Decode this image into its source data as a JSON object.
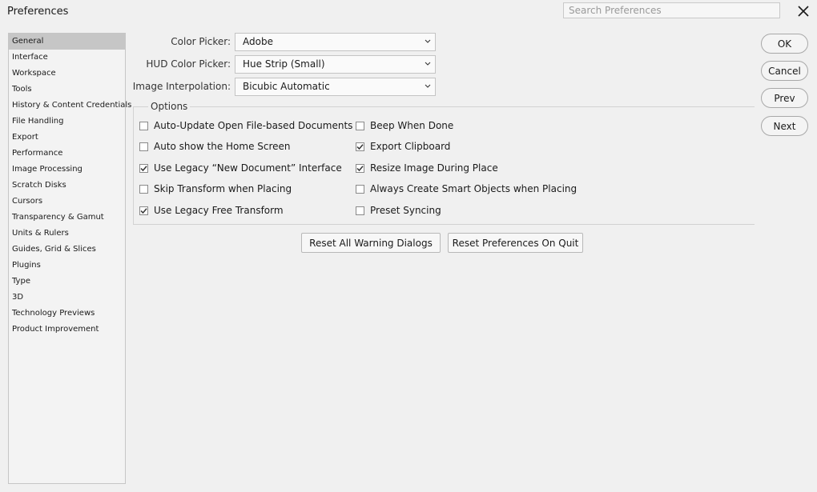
{
  "window": {
    "title": "Preferences"
  },
  "search": {
    "placeholder": "Search Preferences"
  },
  "sidebar": {
    "items": [
      {
        "label": "General",
        "selected": true
      },
      {
        "label": "Interface"
      },
      {
        "label": "Workspace"
      },
      {
        "label": "Tools"
      },
      {
        "label": "History & Content Credentials"
      },
      {
        "label": "File Handling"
      },
      {
        "label": "Export"
      },
      {
        "label": "Performance"
      },
      {
        "label": "Image Processing"
      },
      {
        "label": "Scratch Disks"
      },
      {
        "label": "Cursors"
      },
      {
        "label": "Transparency & Gamut"
      },
      {
        "label": "Units & Rulers"
      },
      {
        "label": "Guides, Grid & Slices"
      },
      {
        "label": "Plugins"
      },
      {
        "label": "Type"
      },
      {
        "label": "3D"
      },
      {
        "label": "Technology Previews"
      },
      {
        "label": "Product Improvement"
      }
    ]
  },
  "fields": {
    "color_picker": {
      "label": "Color Picker:",
      "value": "Adobe"
    },
    "hud_color_picker": {
      "label": "HUD Color Picker:",
      "value": "Hue Strip (Small)"
    },
    "image_interpolation": {
      "label": "Image Interpolation:",
      "value": "Bicubic Automatic"
    }
  },
  "options": {
    "legend": "Options",
    "left": [
      {
        "label": "Auto-Update Open File-based Documents",
        "checked": false
      },
      {
        "label": "Auto show the Home Screen",
        "checked": false
      },
      {
        "label": "Use Legacy “New Document” Interface",
        "checked": true
      },
      {
        "label": "Skip Transform when Placing",
        "checked": false
      },
      {
        "label": "Use Legacy Free Transform",
        "checked": true
      }
    ],
    "right": [
      {
        "label": "Beep When Done",
        "checked": false
      },
      {
        "label": "Export Clipboard",
        "checked": true
      },
      {
        "label": "Resize Image During Place",
        "checked": true
      },
      {
        "label": "Always Create Smart Objects when Placing",
        "checked": false
      },
      {
        "label": "Preset Syncing",
        "checked": false
      }
    ]
  },
  "buttons": {
    "reset_warnings": "Reset All Warning Dialogs",
    "reset_prefs": "Reset Preferences On Quit",
    "ok": "OK",
    "cancel": "Cancel",
    "prev": "Prev",
    "next": "Next"
  }
}
